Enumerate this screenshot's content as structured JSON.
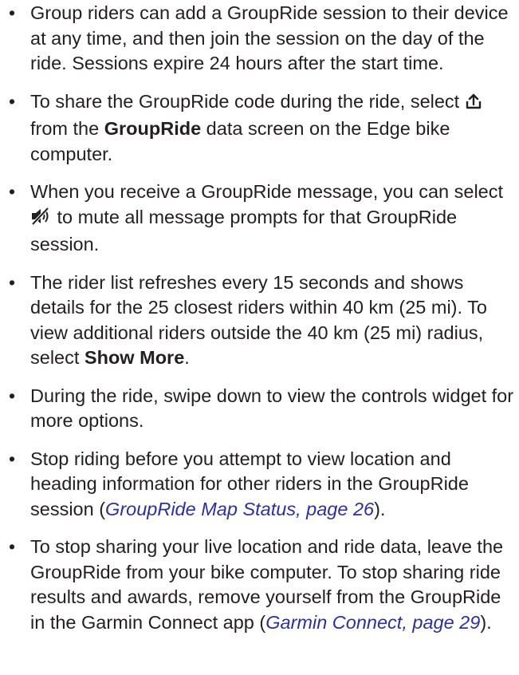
{
  "bullets": [
    {
      "text": "Group riders can add a GroupRide session to their device at any time, and then join the session on the day of the ride. Sessions expire 24 hours after the start time."
    },
    {
      "pre": "To share the GroupRide code during the ride, select ",
      "icon": "share-icon",
      "mid": " from the ",
      "bold": "GroupRide",
      "post": " data screen on the Edge bike computer."
    },
    {
      "pre": "When you receive a GroupRide message, you can select ",
      "icon": "mute-icon",
      "post": " to mute all message prompts for that GroupRide session."
    },
    {
      "pre": "The rider list refreshes every 15 seconds and shows details for the 25 closest riders within 40 km (25 mi). To view additional riders outside the 40 km (25 mi) radius, select ",
      "bold": "Show More",
      "post": "."
    },
    {
      "text": "During the ride, swipe down to view the controls widget for more options."
    },
    {
      "pre": "Stop riding before you attempt to view location and heading information for other riders in the GroupRide session (",
      "link": "GroupRide Map Status, page 26",
      "post": ")."
    },
    {
      "pre": "To stop sharing your live location and ride data, leave the GroupRide from your bike computer. To stop sharing ride results and awards, remove yourself from the GroupRide in the Garmin Connect app (",
      "link": "Garmin Connect, page 29",
      "post": ")."
    }
  ],
  "bullet_char": "•",
  "colors": {
    "text": "#231f20",
    "link": "#2e3192"
  }
}
